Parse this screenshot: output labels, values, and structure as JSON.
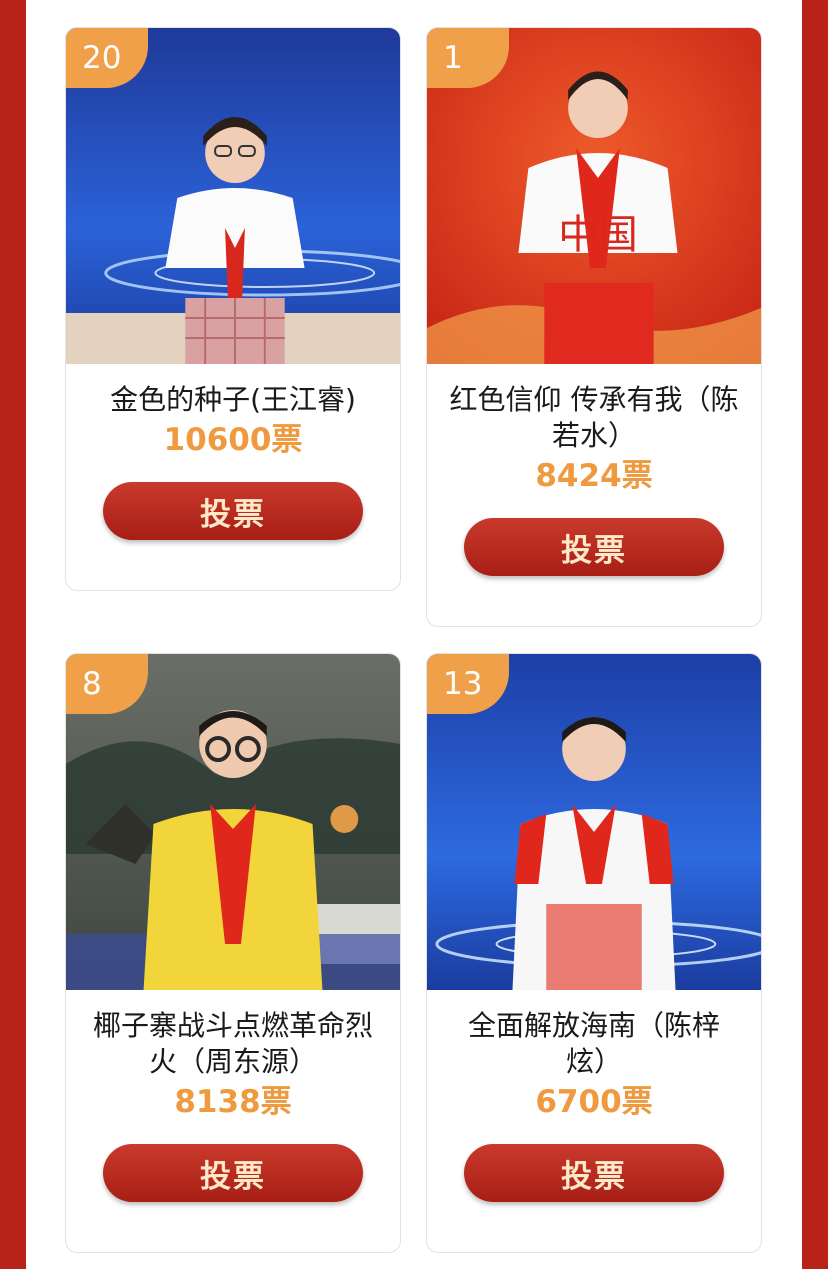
{
  "vote_button_label": "投票",
  "contestants": [
    {
      "rank": "20",
      "title": "金色的种子(王江睿)",
      "votes": "10600票",
      "backdrop": "blue-stage"
    },
    {
      "rank": "1",
      "title": "红色信仰 传承有我（陈若水）",
      "votes": "8424票",
      "backdrop": "red-stage"
    },
    {
      "rank": "8",
      "title": "椰子寨战斗点燃革命烈火（周东源）",
      "votes": "8138票",
      "backdrop": "museum-mural"
    },
    {
      "rank": "13",
      "title": "全面解放海南（陈梓炫）",
      "votes": "6700票",
      "backdrop": "blue-stage"
    }
  ],
  "colors": {
    "frame": "#b82218",
    "badge": "#f0a048",
    "votes": "#ef9a3f",
    "button": "#b8281c",
    "button_text": "#fde8c8"
  }
}
